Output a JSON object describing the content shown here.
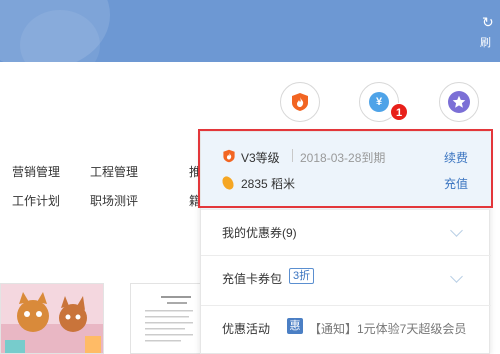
{
  "header": {
    "refresh_icon": "refresh-icon",
    "refresh_label": "刷"
  },
  "menu": {
    "row1": [
      "营销管理",
      "工程管理",
      "推"
    ],
    "row2": [
      "工作计划",
      "职场测评",
      "籍"
    ]
  },
  "icons": {
    "vip": "shield-flame-icon",
    "currency": "yen-icon",
    "currency_glyph": "¥",
    "favorite": "star-icon",
    "badge_count": "1"
  },
  "member": {
    "level": "V3等级",
    "expiry": "2018-03-28到期",
    "renew_label": "续费",
    "balance": "2835 稻米",
    "recharge_label": "充值"
  },
  "panel": {
    "coupons_label": "我的优惠券(9)",
    "card_pack_label": "充值卡券包",
    "card_pack_discount": "3折",
    "promo_label": "优惠活动",
    "promo_tag": "惠",
    "promo_text": "【通知】1元体验7天超级会员"
  },
  "colors": {
    "header": "#6d98d3",
    "accent": "#3a74c0",
    "highlight_border": "#e3363a",
    "vip_orange": "#f26522",
    "coin_gold": "#f5a623",
    "star_purple": "#7b6fd6",
    "yen_blue": "#4ea3e8",
    "badge_red": "#e8201a"
  }
}
